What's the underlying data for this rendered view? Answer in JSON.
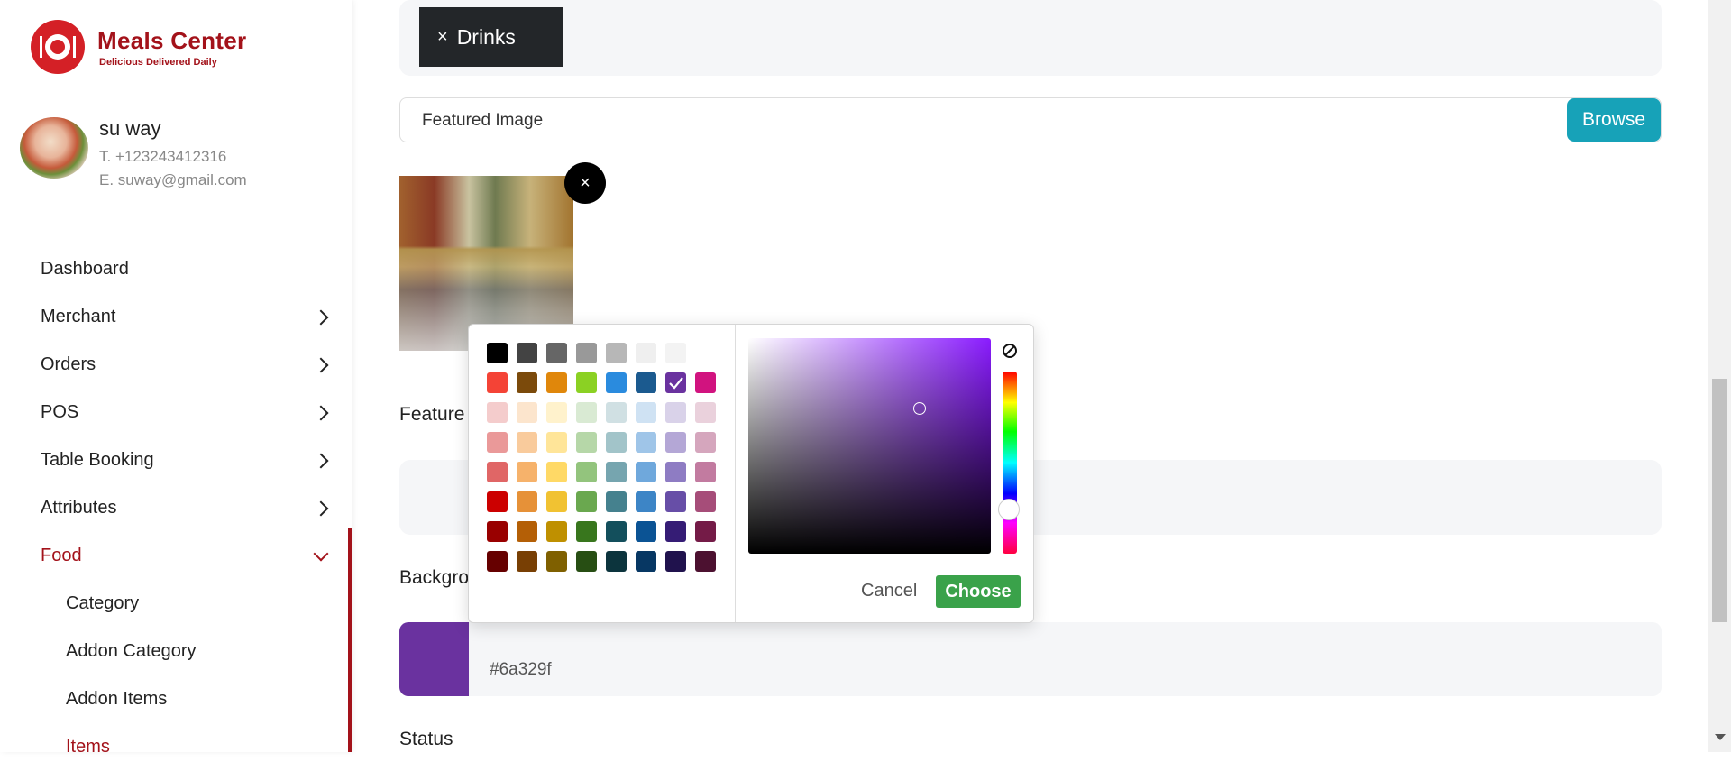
{
  "brand": {
    "title": "Meals Center",
    "tagline": "Delicious Delivered Daily"
  },
  "profile": {
    "name": "su way",
    "phone": "T. +123243412316",
    "email": "E. suway@gmail.com"
  },
  "nav": {
    "items": [
      {
        "label": "Dashboard",
        "chevron": false
      },
      {
        "label": "Merchant",
        "chevron": true
      },
      {
        "label": "Orders",
        "chevron": true
      },
      {
        "label": "POS",
        "chevron": true
      },
      {
        "label": "Table Booking",
        "chevron": true
      },
      {
        "label": "Attributes",
        "chevron": true
      },
      {
        "label": "Food",
        "chevron": true,
        "active": true
      }
    ],
    "subitems": [
      {
        "label": "Category"
      },
      {
        "label": "Addon Category"
      },
      {
        "label": "Addon Items"
      },
      {
        "label": "Items",
        "active": true
      }
    ]
  },
  "form": {
    "tag_label": "Drinks",
    "tag_remove": "×",
    "featured_image_label": "Featured Image",
    "browse_label": "Browse",
    "thumb_remove": "×",
    "featured_label_partial": "Feature",
    "background_label_partial": "Backgro",
    "background_hex": "#6a329f",
    "status_label": "Status"
  },
  "color_picker": {
    "cancel_label": "Cancel",
    "choose_label": "Choose",
    "selected_color": "#6a329f",
    "palette": [
      [
        "#000000",
        "#434343",
        "#666666",
        "#999999",
        "#b7b7b7",
        "#efefef",
        "#f3f3f3",
        "#ffffff"
      ],
      [
        "#f44336",
        "#7b4a0b",
        "#e0870b",
        "#8bd123",
        "#2a8bde",
        "#1b5a8f",
        "#6a329f",
        "#d1137f"
      ],
      [
        "#f4cccc",
        "#fce5cd",
        "#fff2cc",
        "#d9ead3",
        "#d0e0e3",
        "#cfe2f3",
        "#d9d2e9",
        "#ead1dc"
      ],
      [
        "#ea9999",
        "#f9cb9c",
        "#ffe599",
        "#b6d7a8",
        "#a2c4c9",
        "#9fc5e8",
        "#b4a7d6",
        "#d5a6bd"
      ],
      [
        "#e06666",
        "#f6b26b",
        "#ffd966",
        "#93c47d",
        "#76a5af",
        "#6fa8dc",
        "#8e7cc3",
        "#c27ba0"
      ],
      [
        "#cc0000",
        "#e69138",
        "#f1c232",
        "#6aa84f",
        "#45818e",
        "#3d85c6",
        "#674ea7",
        "#a64d79"
      ],
      [
        "#990000",
        "#b45f06",
        "#bf9000",
        "#38761d",
        "#134f5c",
        "#0b5394",
        "#351c75",
        "#741b47"
      ],
      [
        "#660000",
        "#783f04",
        "#7f6000",
        "#274e13",
        "#0c343d",
        "#073763",
        "#20124d",
        "#4c1130"
      ]
    ]
  },
  "colors": {
    "accent": "#a3121a",
    "info": "#17a2b8",
    "success": "#3aa24a",
    "tag_bg": "#232629"
  }
}
